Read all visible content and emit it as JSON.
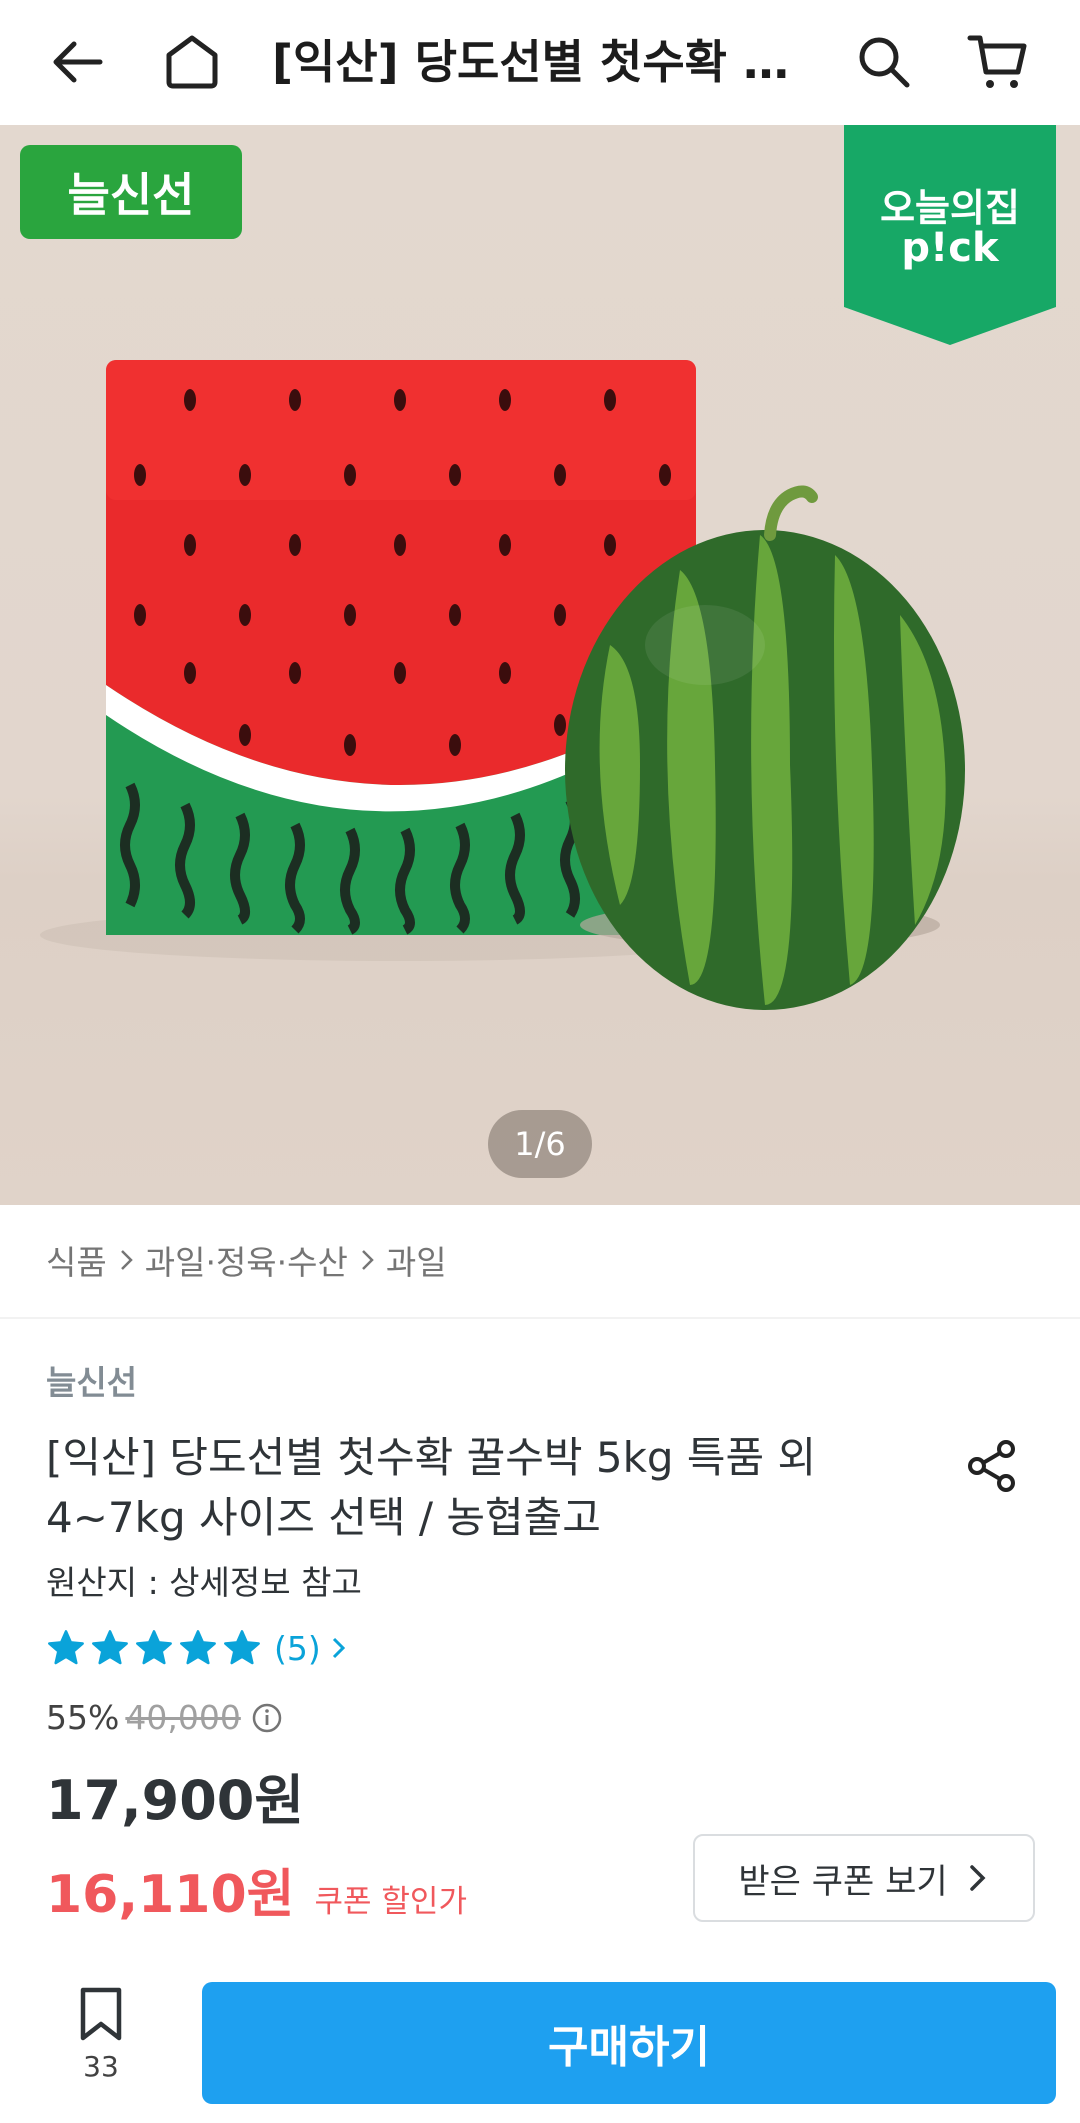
{
  "header": {
    "title": "[익산] 당도선별  첫수확 꿀…"
  },
  "hero": {
    "fresh_badge": "늘신선",
    "pick_badge_line1": "오늘의집",
    "pick_badge_line2": "p!ck",
    "page_indicator": "1/6"
  },
  "breadcrumb": {
    "items": [
      "식품",
      "과일·정육·수산",
      "과일"
    ]
  },
  "product": {
    "brand": "늘신선",
    "title": "[익산] 당도선별  첫수확 꿀수박 5kg 특품 외 4~7kg 사이즈 선택 / 농협출고",
    "origin": "원산지 : 상세정보 참고",
    "rating_stars": 5,
    "review_count": "(5)",
    "discount_rate": "55%",
    "original_price": "40,000",
    "price": "17,900원",
    "coupon_price": "16,110원",
    "coupon_label": "쿠폰 할인가",
    "coupon_button": "받은 쿠폰 보기"
  },
  "bottom": {
    "bookmark_count": "33",
    "buy_button": "구매하기"
  },
  "colors": {
    "accent": "#1ea0f0",
    "sale": "#f0585c",
    "fresh_green": "#2aa53e",
    "pick_green": "#17a866",
    "star_blue": "#0aa3d9"
  }
}
